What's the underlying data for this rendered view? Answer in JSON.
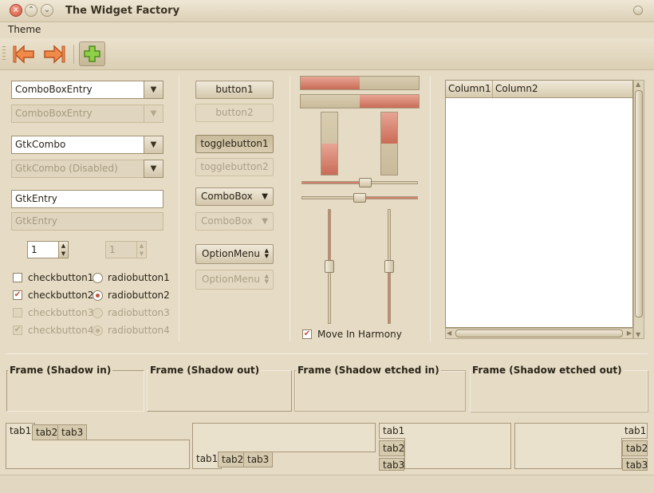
{
  "window": {
    "title": "The Widget Factory"
  },
  "menubar": {
    "items": [
      "Theme"
    ]
  },
  "entries": {
    "comboboxentry": "ComboBoxEntry",
    "comboboxentry_disabled": "ComboBoxEntry",
    "gtkcombo": "GtkCombo",
    "gtkcombo_disabled": "GtkCombo (Disabled)",
    "gtkentry": "GtkEntry",
    "gtkentry_disabled": "GtkEntry",
    "spin": "1",
    "spin_disabled": "1"
  },
  "checks": [
    {
      "label": "checkbutton1",
      "checked": false,
      "disabled": false
    },
    {
      "label": "checkbutton2",
      "checked": true,
      "disabled": false
    },
    {
      "label": "checkbutton3",
      "checked": false,
      "disabled": true
    },
    {
      "label": "checkbutton4",
      "checked": true,
      "disabled": true
    }
  ],
  "radios": [
    {
      "label": "radiobutton1",
      "checked": false,
      "disabled": false
    },
    {
      "label": "radiobutton2",
      "checked": true,
      "disabled": false
    },
    {
      "label": "radiobutton3",
      "checked": false,
      "disabled": true
    },
    {
      "label": "radiobutton4",
      "checked": true,
      "disabled": true
    }
  ],
  "buttons": {
    "button1": "button1",
    "button2": "button2",
    "toggle1": "togglebutton1",
    "toggle2": "togglebutton2",
    "combobox": "ComboBox",
    "combobox_disabled": "ComboBox",
    "optionmenu": "OptionMenu",
    "optionmenu_disabled": "OptionMenu"
  },
  "progress": {
    "h1": 0.5,
    "h2": 0.5,
    "v1": 0.5,
    "v2": 0.5
  },
  "scales": {
    "h1": 0.55,
    "h2": 0.5,
    "v1": 0.5,
    "v2": 0.5
  },
  "harmony": {
    "label": "Move In Harmony",
    "checked": true
  },
  "tree": {
    "columns": [
      "Column1",
      "Column2"
    ]
  },
  "frames": [
    "Frame (Shadow in)",
    "Frame (Shadow out)",
    "Frame (Shadow etched in)",
    "Frame (Shadow etched out)"
  ],
  "tabs": [
    "tab1",
    "tab2",
    "tab3"
  ],
  "colors": {
    "accent": "#c96c57",
    "background": "#e6dcc6"
  }
}
